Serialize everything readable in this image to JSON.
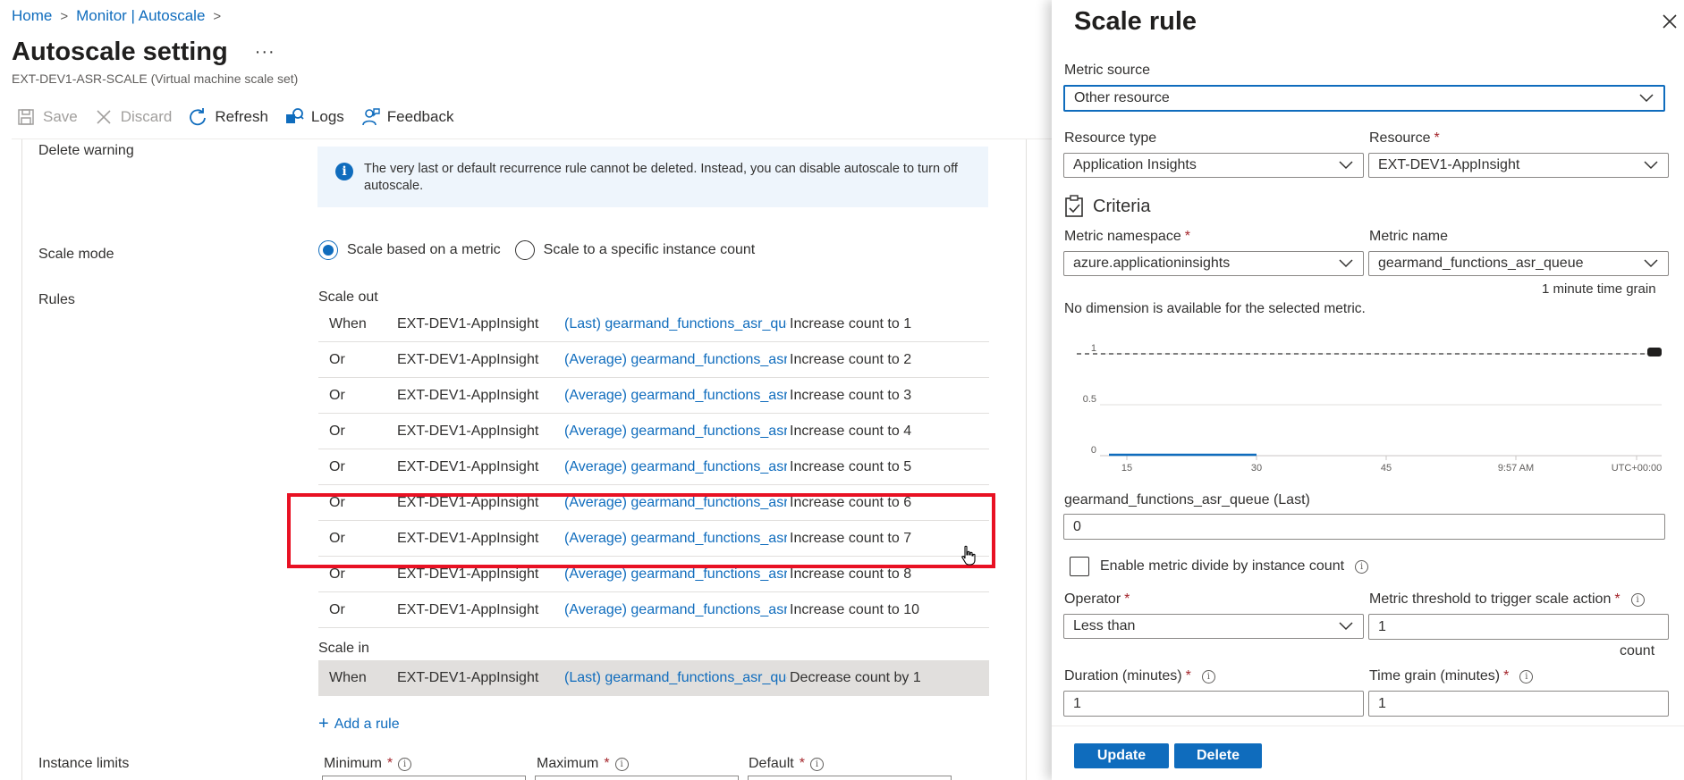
{
  "breadcrumb": {
    "home": "Home",
    "monitor": "Monitor | Autoscale"
  },
  "page": {
    "title": "Autoscale setting",
    "more": "···",
    "subtitle": "EXT-DEV1-ASR-SCALE (Virtual machine scale set)"
  },
  "toolbar": {
    "save": "Save",
    "discard": "Discard",
    "refresh": "Refresh",
    "logs": "Logs",
    "feedback": "Feedback"
  },
  "delete_warning": {
    "label": "Delete warning",
    "message": "The very last or default recurrence rule cannot be deleted. Instead, you can disable autoscale to turn off autoscale."
  },
  "scale_mode": {
    "label": "Scale mode",
    "options": [
      "Scale based on a metric",
      "Scale to a specific instance count"
    ],
    "selected": 0
  },
  "rules": {
    "label": "Rules",
    "scale_out_label": "Scale out",
    "scale_out": [
      {
        "cond": "When",
        "resource": "EXT-DEV1-AppInsight",
        "metric": "(Last) gearmand_functions_asr_queue",
        "action": "Increase count to 1"
      },
      {
        "cond": "Or",
        "resource": "EXT-DEV1-AppInsight",
        "metric": "(Average) gearmand_functions_asr_queue",
        "action": "Increase count to 2"
      },
      {
        "cond": "Or",
        "resource": "EXT-DEV1-AppInsight",
        "metric": "(Average) gearmand_functions_asr_queue",
        "action": "Increase count to 3"
      },
      {
        "cond": "Or",
        "resource": "EXT-DEV1-AppInsight",
        "metric": "(Average) gearmand_functions_asr_queue",
        "action": "Increase count to 4"
      },
      {
        "cond": "Or",
        "resource": "EXT-DEV1-AppInsight",
        "metric": "(Average) gearmand_functions_asr_queue",
        "action": "Increase count to 5"
      },
      {
        "cond": "Or",
        "resource": "EXT-DEV1-AppInsight",
        "metric": "(Average) gearmand_functions_asr_queue",
        "action": "Increase count to 6"
      },
      {
        "cond": "Or",
        "resource": "EXT-DEV1-AppInsight",
        "metric": "(Average) gearmand_functions_asr_queue",
        "action": "Increase count to 7"
      },
      {
        "cond": "Or",
        "resource": "EXT-DEV1-AppInsight",
        "metric": "(Average) gearmand_functions_asr_queue",
        "action": "Increase count to 8"
      },
      {
        "cond": "Or",
        "resource": "EXT-DEV1-AppInsight",
        "metric": "(Average) gearmand_functions_asr_queue",
        "action": "Increase count to 10"
      }
    ],
    "scale_in_label": "Scale in",
    "scale_in": [
      {
        "cond": "When",
        "resource": "EXT-DEV1-AppInsight",
        "metric": "(Last) gearmand_functions_asr_queue",
        "action": "Decrease count by 1"
      }
    ],
    "add_rule": "Add a rule"
  },
  "instance_limits": {
    "label": "Instance limits",
    "minimum": "Minimum",
    "maximum": "Maximum",
    "default": "Default"
  },
  "panel": {
    "title": "Scale rule",
    "metric_source_label": "Metric source",
    "metric_source": "Other resource",
    "resource_type_label": "Resource type",
    "resource_type": "Application Insights",
    "resource_label": "Resource",
    "resource": "EXT-DEV1-AppInsight",
    "criteria": "Criteria",
    "metric_namespace_label": "Metric namespace",
    "metric_namespace": "azure.applicationinsights",
    "metric_name_label": "Metric name",
    "metric_name": "gearmand_functions_asr_queue",
    "time_grain_note": "1 minute time grain",
    "no_dimension": "No dimension is available for the selected metric.",
    "metric_value_label": "gearmand_functions_asr_queue (Last)",
    "metric_value": "0",
    "divide_label": "Enable metric divide by instance count",
    "operator_label": "Operator",
    "operator": "Less than",
    "threshold_label": "Metric threshold to trigger scale action",
    "threshold": "1",
    "count_label": "count",
    "duration_label": "Duration (minutes)",
    "duration": "1",
    "time_grain_label": "Time grain (minutes)",
    "time_grain": "1",
    "update": "Update",
    "delete": "Delete"
  },
  "chart_data": {
    "type": "line",
    "x_ticks": [
      "15",
      "30",
      "45",
      "9:57 AM",
      "UTC+00:00"
    ],
    "y_ticks": [
      "0",
      "0.5",
      "1"
    ],
    "ylim": [
      0,
      1
    ],
    "threshold": 1,
    "series": [
      {
        "values_x": [
          "15",
          "30"
        ],
        "values": [
          0,
          0
        ]
      }
    ],
    "grid": true
  },
  "colors": {
    "accent": "#0f6cbd",
    "highlight": "#e81123"
  }
}
